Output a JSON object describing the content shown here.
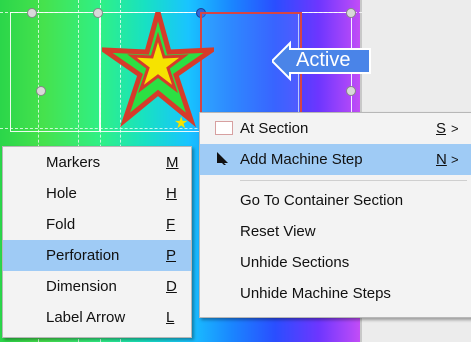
{
  "colors": {
    "accent": "#9fcbf5",
    "menu_bg": "#f3f3f3",
    "active_box": "#6d8ff8",
    "active_label_bg": "#4a84e8",
    "star_outline": "#d63b2a",
    "star_fill": "#f6e300"
  },
  "canvas": {
    "active_label": "Active"
  },
  "menus": {
    "left": {
      "items": [
        {
          "label": "Markers",
          "shortcut": "M",
          "selected": false
        },
        {
          "label": "Hole",
          "shortcut": "H",
          "selected": false
        },
        {
          "label": "Fold",
          "shortcut": "F",
          "selected": false
        },
        {
          "label": "Perforation",
          "shortcut": "P",
          "selected": true
        },
        {
          "label": "Dimension",
          "shortcut": "D",
          "selected": false
        },
        {
          "label": "Label Arrow",
          "shortcut": "L",
          "selected": false
        }
      ]
    },
    "right": {
      "items": [
        {
          "label": "At Section",
          "shortcut": "S",
          "submenu": true,
          "icon": "section-icon",
          "selected": false
        },
        {
          "label": "Add Machine Step",
          "shortcut": "N",
          "submenu": true,
          "icon": "cursor-icon",
          "selected": true
        },
        {
          "label": "Go To Container Section",
          "shortcut": "",
          "submenu": false,
          "icon": "",
          "selected": false
        },
        {
          "label": "Reset View",
          "shortcut": "",
          "submenu": false,
          "icon": "",
          "selected": false
        },
        {
          "label": "Unhide Sections",
          "shortcut": "",
          "submenu": false,
          "icon": "",
          "selected": false
        },
        {
          "label": "Unhide Machine Steps",
          "shortcut": "",
          "submenu": false,
          "icon": "",
          "selected": false
        }
      ],
      "submenu_arrow": ">"
    }
  }
}
